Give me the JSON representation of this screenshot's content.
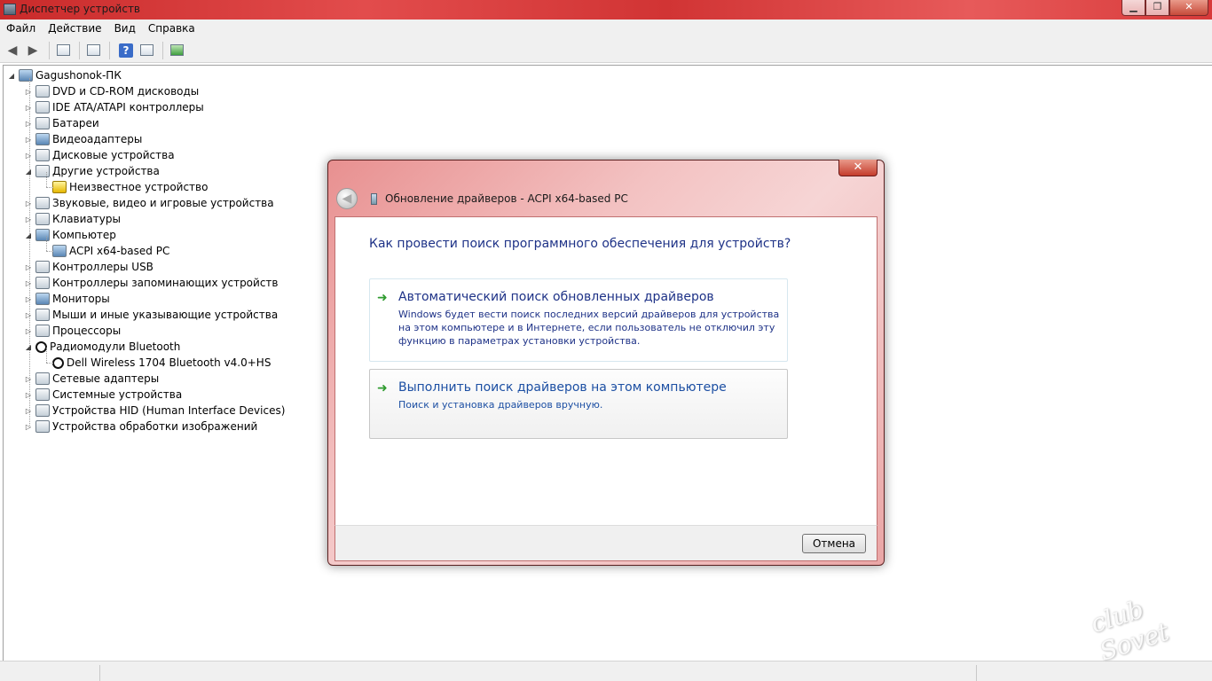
{
  "window": {
    "title": "Диспетчер устройств",
    "caption_buttons": {
      "minimize": "▁",
      "maximize": "❐",
      "close": "✕"
    }
  },
  "menu": [
    "Файл",
    "Действие",
    "Вид",
    "Справка"
  ],
  "toolbar": {
    "back_glyph": "◀",
    "forward_glyph": "▶",
    "help_glyph": "?",
    "icons": [
      "back-icon",
      "forward-icon",
      "properties-icon",
      "view-icon",
      "help-icon",
      "scan-icon",
      "update-driver-icon"
    ]
  },
  "tree": {
    "root": "Gagushonok-ПК",
    "expand_closed": "▷",
    "expand_open": "◢",
    "items": [
      {
        "label": "DVD и CD-ROM дисководы",
        "icon": "dvd-drive-icon",
        "expanded": false,
        "level": 1
      },
      {
        "label": "IDE ATA/ATAPI контроллеры",
        "icon": "ide-controller-icon",
        "expanded": false,
        "level": 1
      },
      {
        "label": "Батареи",
        "icon": "battery-icon",
        "expanded": false,
        "level": 1
      },
      {
        "label": "Видеоадаптеры",
        "icon": "display-adapter-icon",
        "expanded": false,
        "level": 1
      },
      {
        "label": "Дисковые устройства",
        "icon": "disk-drive-icon",
        "expanded": false,
        "level": 1
      },
      {
        "label": "Другие устройства",
        "icon": "other-devices-icon",
        "expanded": true,
        "level": 1
      },
      {
        "label": "Неизвестное устройство",
        "icon": "unknown-device-warning-icon",
        "level": 2
      },
      {
        "label": "Звуковые, видео и игровые устройства",
        "icon": "sound-icon",
        "expanded": false,
        "level": 1
      },
      {
        "label": "Клавиатуры",
        "icon": "keyboard-icon",
        "expanded": false,
        "level": 1
      },
      {
        "label": "Компьютер",
        "icon": "computer-icon",
        "expanded": true,
        "level": 1
      },
      {
        "label": "ACPI x64-based PC",
        "icon": "acpi-pc-icon",
        "level": 2
      },
      {
        "label": "Контроллеры USB",
        "icon": "usb-icon",
        "expanded": false,
        "level": 1
      },
      {
        "label": "Контроллеры запоминающих устройств",
        "icon": "storage-controller-icon",
        "expanded": false,
        "level": 1
      },
      {
        "label": "Мониторы",
        "icon": "monitor-icon",
        "expanded": false,
        "level": 1
      },
      {
        "label": "Мыши и иные указывающие устройства",
        "icon": "mouse-icon",
        "expanded": false,
        "level": 1
      },
      {
        "label": "Процессоры",
        "icon": "processor-icon",
        "expanded": false,
        "level": 1
      },
      {
        "label": "Радиомодули Bluetooth",
        "icon": "bluetooth-icon",
        "expanded": true,
        "level": 1
      },
      {
        "label": "Dell Wireless 1704 Bluetooth v4.0+HS",
        "icon": "bluetooth-device-icon",
        "level": 2
      },
      {
        "label": "Сетевые адаптеры",
        "icon": "network-adapter-icon",
        "expanded": false,
        "level": 1
      },
      {
        "label": "Системные устройства",
        "icon": "system-devices-icon",
        "expanded": false,
        "level": 1
      },
      {
        "label": "Устройства HID (Human Interface Devices)",
        "icon": "hid-icon",
        "expanded": false,
        "level": 1
      },
      {
        "label": "Устройства обработки изображений",
        "icon": "imaging-device-icon",
        "expanded": false,
        "level": 1
      }
    ]
  },
  "dialog": {
    "title": "Обновление драйверов - ACPI x64-based PC",
    "close_glyph": "✕",
    "back_glyph": "◀",
    "heading": "Как провести поиск программного обеспечения для устройств?",
    "option_arrow": "➜",
    "option_auto": {
      "title": "Автоматический поиск обновленных драйверов",
      "description": "Windows будет вести поиск последних версий драйверов для устройства на этом компьютере и в Интернете, если пользователь не отключил эту функцию в параметрах установки устройства."
    },
    "option_manual": {
      "title": "Выполнить поиск драйверов на этом компьютере",
      "description": "Поиск и установка драйверов вручную."
    },
    "cancel_label": "Отмена"
  },
  "watermark": "club Sovet"
}
